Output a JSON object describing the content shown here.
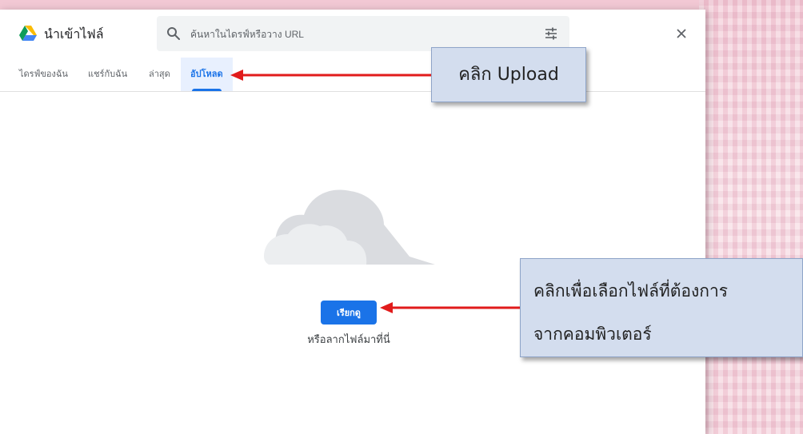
{
  "dialog": {
    "title": "นำเข้าไฟล์",
    "search_placeholder": "ค้นหาในไดรฟ์หรือวาง URL"
  },
  "tabs": [
    {
      "label": "ไดรฟ์ของฉัน",
      "active": false
    },
    {
      "label": "แชร์กับฉัน",
      "active": false
    },
    {
      "label": "ล่าสุด",
      "active": false
    },
    {
      "label": "อัปโหลด",
      "active": true
    }
  ],
  "upload": {
    "browse_label": "เรียกดู",
    "drop_text": "หรือลากไฟล์มาที่นี่"
  },
  "annotations": {
    "upload_callout": "คลิก Upload",
    "browse_callout_line1": "คลิกเพื่อเลือกไฟล์ที่ต้องการ",
    "browse_callout_line2": "จากคอมพิวเตอร์"
  },
  "icons": [
    "google-drive-logo-icon",
    "search-icon",
    "tune-icon",
    "close-icon",
    "cloud-upload-icon"
  ],
  "colors": {
    "accent": "#1a73e8",
    "arrow": "#e11b1b",
    "callout": "#d3ddee",
    "tab_active_bg": "#e8f0fe"
  }
}
